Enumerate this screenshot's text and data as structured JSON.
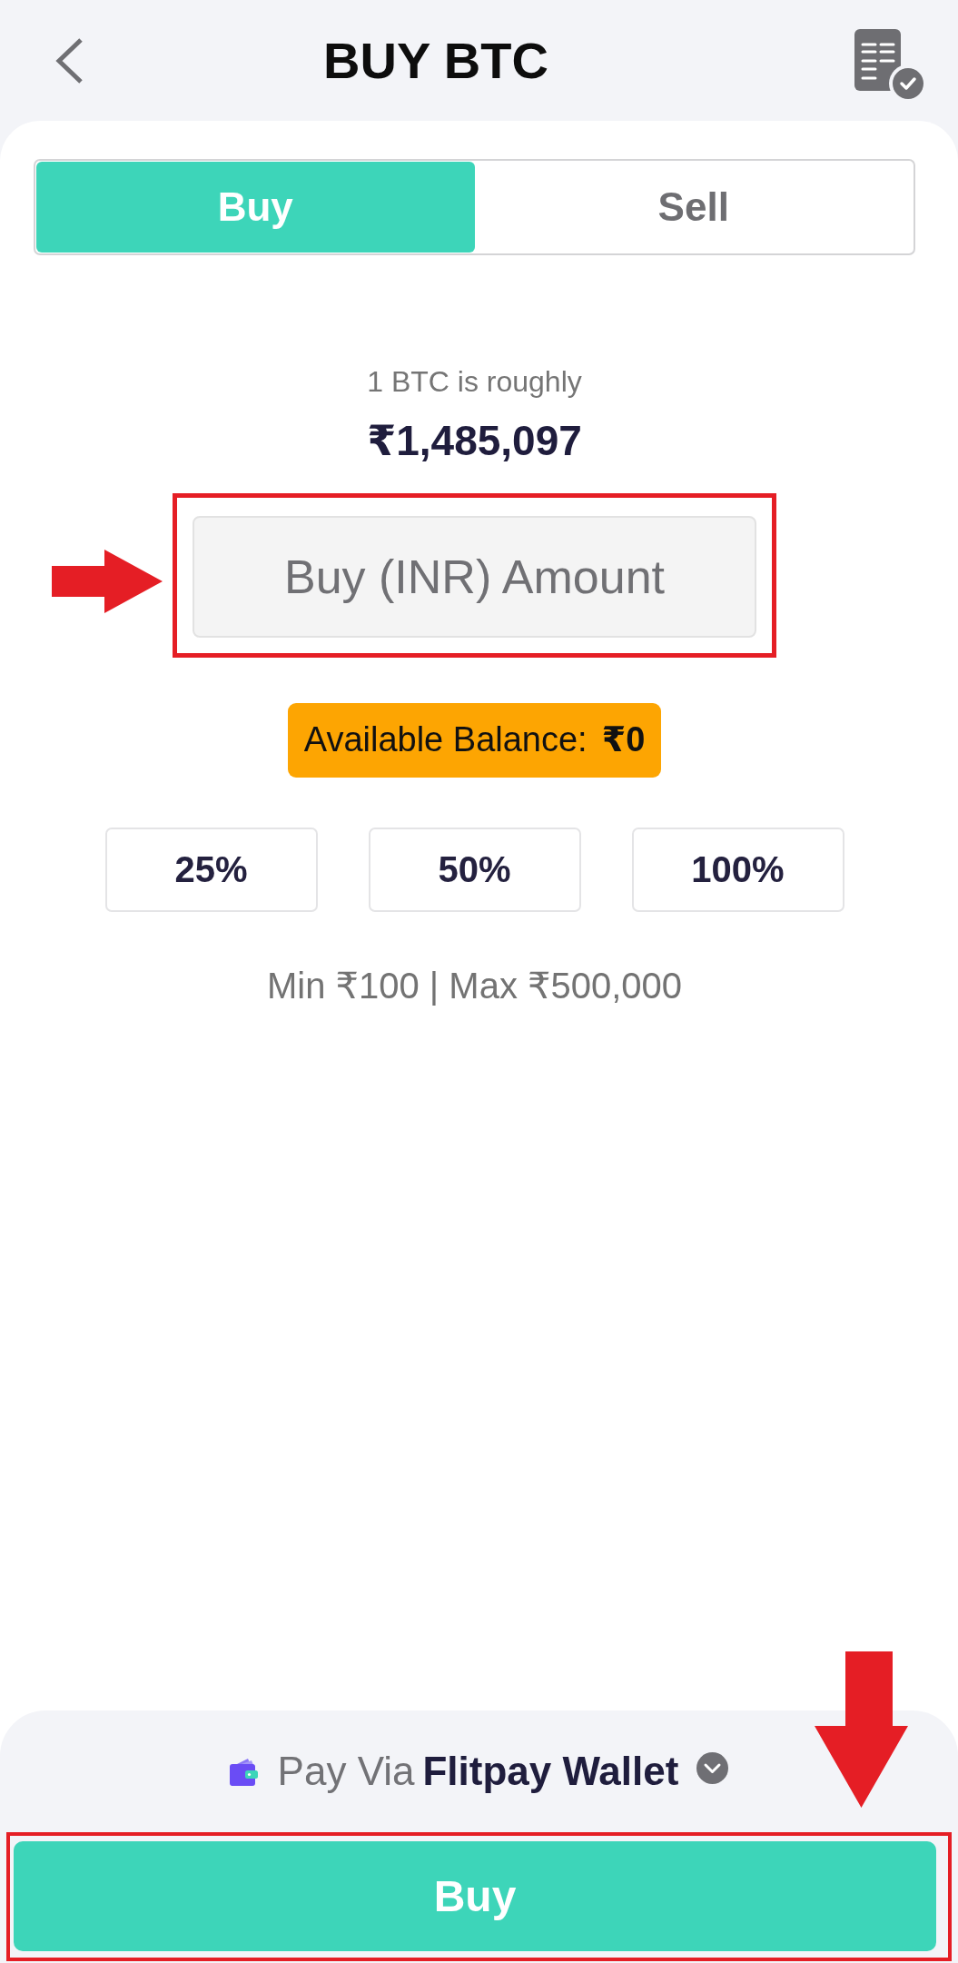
{
  "header": {
    "title": "BUY BTC"
  },
  "tabs": [
    {
      "label": "Buy",
      "selected": true
    },
    {
      "label": "Sell",
      "selected": false
    }
  ],
  "rate": {
    "caption": "1 BTC is roughly",
    "price": "₹1,485,097"
  },
  "amount_field": {
    "placeholder": "Buy (INR) Amount",
    "highlighted": true
  },
  "balance": {
    "label": "Available Balance:",
    "value": "₹0"
  },
  "percent_buttons": [
    "25%",
    "50%",
    "100%"
  ],
  "limits": "Min ₹100 | Max ₹500,000",
  "payment": {
    "prefix": "Pay Via",
    "method": "Flitpay Wallet"
  },
  "submit_button": {
    "label": "Buy",
    "highlighted": true
  }
}
